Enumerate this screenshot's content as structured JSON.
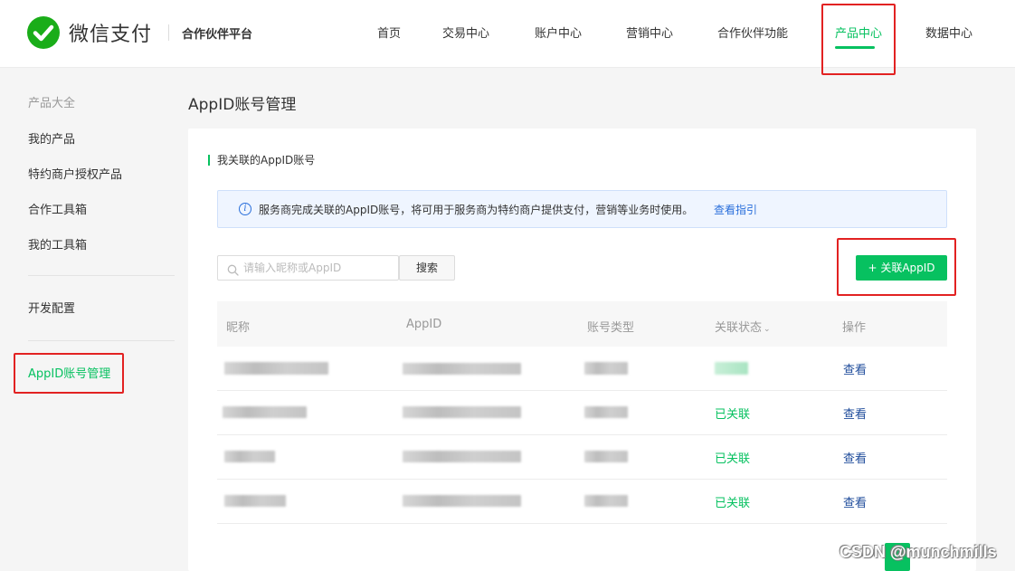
{
  "header": {
    "logo_text": "微信支付",
    "platform_label": "合作伙伴平台",
    "nav": [
      {
        "label": "首页"
      },
      {
        "label": "交易中心"
      },
      {
        "label": "账户中心"
      },
      {
        "label": "营销中心"
      },
      {
        "label": "合作伙伴功能"
      },
      {
        "label": "产品中心"
      },
      {
        "label": "数据中心"
      }
    ],
    "active_nav": "产品中心"
  },
  "sidebar": {
    "group_title": "产品大全",
    "items": [
      {
        "label": "我的产品"
      },
      {
        "label": "特约商户授权产品"
      },
      {
        "label": "合作工具箱"
      },
      {
        "label": "我的工具箱"
      }
    ],
    "dev_config": "开发配置",
    "active_item": "AppID账号管理"
  },
  "main": {
    "page_title": "AppID账号管理",
    "section_title": "我关联的AppID账号",
    "notice": {
      "text": "服务商完成关联的AppID账号，将可用于服务商为特约商户提供支付，营销等业务时使用。",
      "link": "查看指引"
    },
    "search": {
      "placeholder": "请输入昵称或AppID",
      "button": "搜索"
    },
    "add_button": "+ 关联AppID",
    "table": {
      "columns": [
        "昵称",
        "AppID",
        "账号类型",
        "关联状态",
        "操作"
      ],
      "rows": [
        {
          "status": "",
          "action": "查看"
        },
        {
          "status": "已关联",
          "action": "查看"
        },
        {
          "status": "已关联",
          "action": "查看"
        },
        {
          "status": "已关联",
          "action": "查看"
        }
      ]
    }
  },
  "watermark": "CSDN @munchmills",
  "colors": {
    "brand_green": "#07c160",
    "highlight_red": "#e22222",
    "link_blue": "#2a6fdb"
  }
}
